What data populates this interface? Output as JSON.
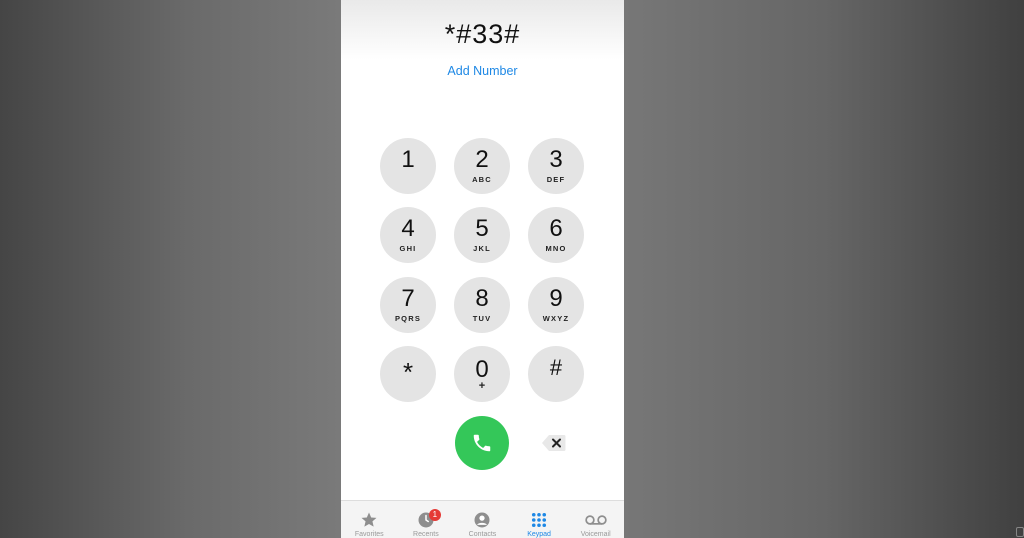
{
  "dialer": {
    "display_number": "*#33#",
    "add_number_label": "Add Number",
    "keys": [
      {
        "digit": "1",
        "letters": ""
      },
      {
        "digit": "2",
        "letters": "ABC"
      },
      {
        "digit": "3",
        "letters": "DEF"
      },
      {
        "digit": "4",
        "letters": "GHI"
      },
      {
        "digit": "5",
        "letters": "JKL"
      },
      {
        "digit": "6",
        "letters": "MNO"
      },
      {
        "digit": "7",
        "letters": "PQRS"
      },
      {
        "digit": "8",
        "letters": "TUV"
      },
      {
        "digit": "9",
        "letters": "WXYZ"
      },
      {
        "digit": "*",
        "letters": ""
      },
      {
        "digit": "0",
        "letters": "+"
      },
      {
        "digit": "#",
        "letters": ""
      }
    ],
    "call_icon": "phone-icon",
    "delete_icon": "backspace-icon",
    "call_color": "#34c759",
    "accent_color": "#1e88e5"
  },
  "tabbar": {
    "tabs": [
      {
        "label": "Favorites",
        "icon": "star-icon"
      },
      {
        "label": "Recents",
        "icon": "clock-icon",
        "badge": "1"
      },
      {
        "label": "Contacts",
        "icon": "person-icon"
      },
      {
        "label": "Keypad",
        "icon": "keypad-icon",
        "active": true
      },
      {
        "label": "Voicemail",
        "icon": "voicemail-icon"
      }
    ]
  }
}
